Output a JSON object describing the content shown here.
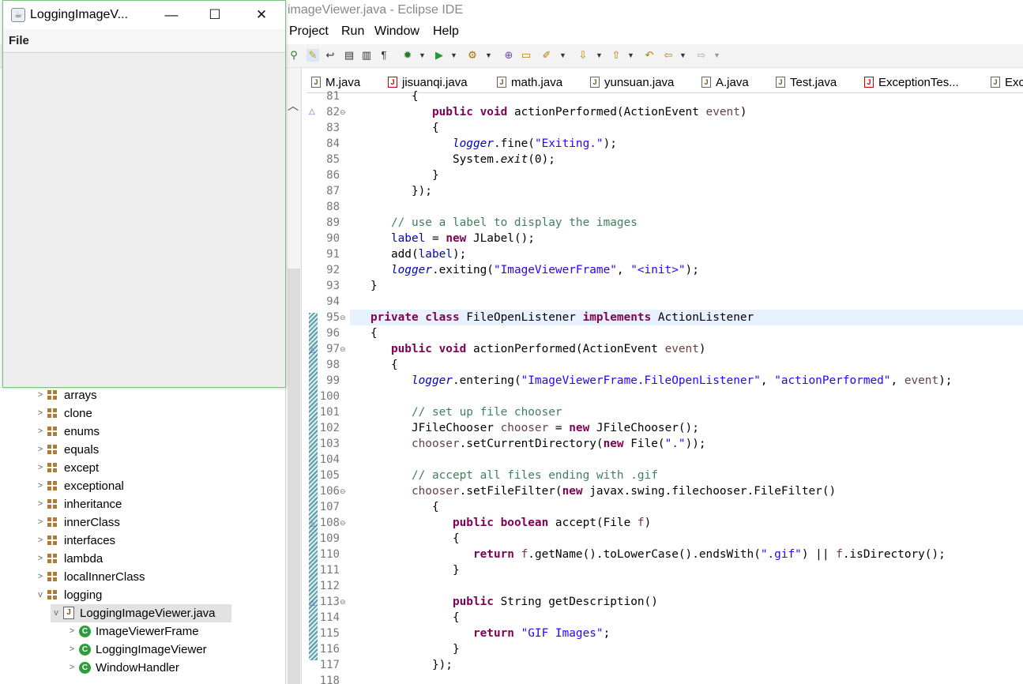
{
  "eclipse": {
    "title": "imageViewer.java - Eclipse IDE",
    "menu": [
      "Project",
      "Run",
      "Window",
      "Help"
    ]
  },
  "frame": {
    "title": "LoggingImageV...",
    "menu_file": "File",
    "minimize": "—",
    "maximize": "☐",
    "close": "✕"
  },
  "explorer": {
    "packages": [
      {
        "label": "arrays",
        "expanded": false
      },
      {
        "label": "clone",
        "expanded": false
      },
      {
        "label": "enums",
        "expanded": false
      },
      {
        "label": "equals",
        "expanded": false
      },
      {
        "label": "except",
        "expanded": false
      },
      {
        "label": "exceptional",
        "expanded": false
      },
      {
        "label": "inheritance",
        "expanded": false
      },
      {
        "label": "innerClass",
        "expanded": false
      },
      {
        "label": "interfaces",
        "expanded": false
      },
      {
        "label": "lambda",
        "expanded": false
      },
      {
        "label": "localInnerClass",
        "expanded": false
      },
      {
        "label": "logging",
        "expanded": true
      }
    ],
    "file": "LoggingImageViewer.java",
    "classes": [
      "ImageViewerFrame",
      "LoggingImageViewer",
      "WindowHandler"
    ]
  },
  "tabs": [
    "M.java",
    "jisuanqi.java",
    "math.java",
    "yunsuan.java",
    "A.java",
    "Test.java",
    "ExceptionTes...",
    "Exc"
  ],
  "line_numbers": [
    "81",
    "82",
    "83",
    "84",
    "85",
    "86",
    "87",
    "88",
    "89",
    "90",
    "91",
    "92",
    "93",
    "94",
    "95",
    "96",
    "97",
    "98",
    "99",
    "100",
    "101",
    "102",
    "103",
    "104",
    "105",
    "106",
    "107",
    "108",
    "109",
    "110",
    "111",
    "112",
    "113",
    "114",
    "115",
    "116",
    "117",
    "118"
  ],
  "code": {
    "l81": "         {",
    "l82_a": "            ",
    "l82_kw": "public void",
    "l82_b": " actionPerformed(ActionEvent ",
    "l82_p": "event",
    "l82_c": ")",
    "l83": "            {",
    "l84_a": "               ",
    "l84_f": "logger",
    "l84_b": ".fine(",
    "l84_s": "\"Exiting.\"",
    "l84_c": ");",
    "l85_a": "               System.",
    "l85_i": "exit",
    "l85_b": "(0);",
    "l86": "            }",
    "l87": "         });",
    "l89": "      // use a label to display the images",
    "l90_a": "      ",
    "l90_f": "label",
    "l90_b": " = ",
    "l90_kw": "new",
    "l90_c": " JLabel();",
    "l91_a": "      add(",
    "l91_f": "label",
    "l91_b": ");",
    "l92_a": "      ",
    "l92_f": "logger",
    "l92_b": ".exiting(",
    "l92_s1": "\"ImageViewerFrame\"",
    "l92_c": ", ",
    "l92_s2": "\"<init>\"",
    "l92_d": ");",
    "l93": "   }",
    "l95_a": "   ",
    "l95_kw1": "private class",
    "l95_b": " FileOpenListener ",
    "l95_kw2": "implements",
    "l95_c": " ActionListener",
    "l96": "   {",
    "l97_a": "      ",
    "l97_kw": "public void",
    "l97_b": " actionPerformed(ActionEvent ",
    "l97_p": "event",
    "l97_c": ")",
    "l98": "      {",
    "l99_a": "         ",
    "l99_f": "logger",
    "l99_b": ".entering(",
    "l99_s1": "\"ImageViewerFrame.FileOpenListener\"",
    "l99_c": ", ",
    "l99_s2": "\"actionPerformed\"",
    "l99_d": ", ",
    "l99_p": "event",
    "l99_e": ");",
    "l101": "         // set up file chooser",
    "l102_a": "         JFileChooser ",
    "l102_p": "chooser",
    "l102_b": " = ",
    "l102_kw": "new",
    "l102_c": " JFileChooser();",
    "l103_a": "         ",
    "l103_p": "chooser",
    "l103_b": ".setCurrentDirectory(",
    "l103_kw": "new",
    "l103_c": " File(",
    "l103_s": "\".\"",
    "l103_d": "));",
    "l105": "         // accept all files ending with .gif",
    "l106_a": "         ",
    "l106_p": "chooser",
    "l106_b": ".setFileFilter(",
    "l106_kw": "new",
    "l106_c": " javax.swing.filechooser.FileFilter()",
    "l107": "            {",
    "l108_a": "               ",
    "l108_kw": "public boolean",
    "l108_b": " accept(File ",
    "l108_p": "f",
    "l108_c": ")",
    "l109": "               {",
    "l110_a": "                  ",
    "l110_kw": "return",
    "l110_b": " ",
    "l110_p1": "f",
    "l110_c": ".getName().toLowerCase().endsWith(",
    "l110_s": "\".gif\"",
    "l110_d": ") || ",
    "l110_p2": "f",
    "l110_e": ".isDirectory();",
    "l111": "               }",
    "l113_a": "               ",
    "l113_kw": "public",
    "l113_b": " String getDescription()",
    "l114": "               {",
    "l115_a": "                  ",
    "l115_kw": "return",
    "l115_b": " ",
    "l115_s": "\"GIF Images\"",
    "l115_c": ";",
    "l116": "               }",
    "l117": "            });"
  },
  "colors": {
    "keyword": "#7f0055",
    "string": "#2a00ff",
    "comment": "#3f7f5f",
    "field": "#0000c0",
    "current_line": "#e8f2fe"
  }
}
